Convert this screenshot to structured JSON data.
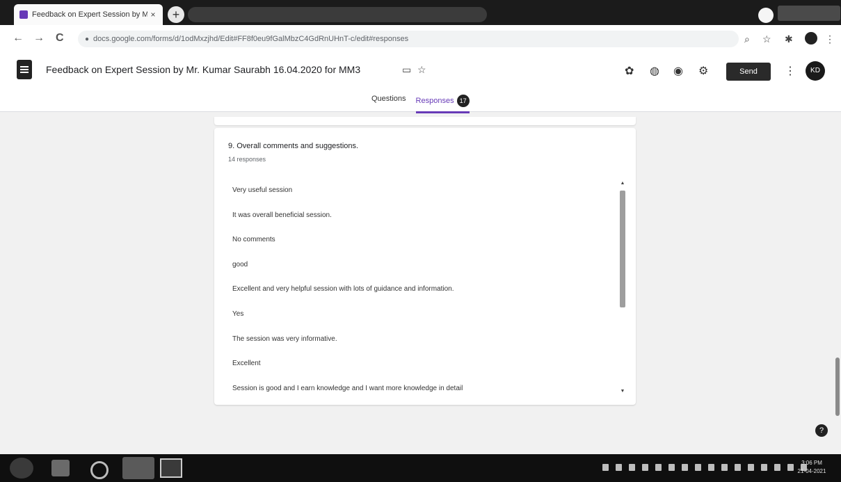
{
  "browser": {
    "tab_title": "Feedback on Expert Session by M",
    "tab_close": "×",
    "new_tab": "+",
    "url": "docs.google.com/forms/d/1odMxzjhd/Edit#FF8f0eu9fGalMbzC4GdRnUHnT-c/edit#responses",
    "nav_back": "←",
    "nav_forward": "→",
    "nav_reload": "C",
    "lock": "●",
    "icons": {
      "zoom": "search-icon",
      "bookmark": "star-icon",
      "extensions": "puzzle-icon",
      "menu": "more-vert-icon"
    }
  },
  "header": {
    "form_title": "Feedback on Expert Session by Mr. Kumar Saurabh 16.04.2020 for MM3",
    "send_label": "Send",
    "more_label": "⋮",
    "avatar_initials": "KD",
    "tabs": {
      "questions": "Questions",
      "responses": "Responses",
      "responses_count": "17"
    }
  },
  "question": {
    "title": "9. Overall comments and suggestions.",
    "count_label": "14 responses",
    "responses": [
      "Very useful session",
      "It was overall beneficial session.",
      "No comments",
      "good",
      "Excellent and very helpful session with lots of guidance and information.",
      "Yes",
      "The session was very informative.",
      "Excellent",
      "Session is good and I earn knowledge and I want more knowledge in detail"
    ]
  },
  "help_label": "?",
  "taskbar": {
    "clock_time": "3:06 PM",
    "clock_date": "21-04-2021"
  },
  "colors": {
    "accent": "#673ab7",
    "header_bg": "#ffffff",
    "page_bg": "#f1f1f1",
    "taskbar": "#0f0f0f"
  }
}
